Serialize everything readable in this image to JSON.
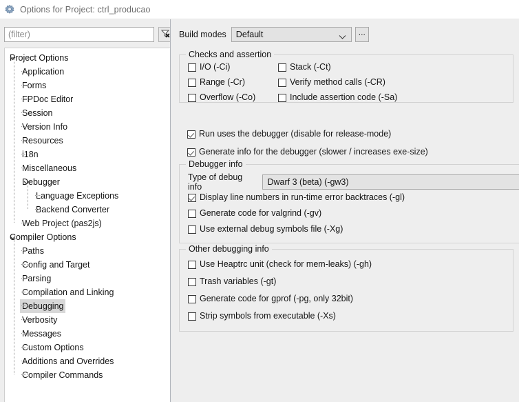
{
  "window": {
    "title": "Options for Project: ctrl_producao",
    "title_icon": "gear-icon"
  },
  "sidebar": {
    "filter": {
      "placeholder": "(filter)",
      "value": "",
      "clear_icon": "filter-clear-icon"
    },
    "items": [
      {
        "label": "Project Options",
        "level": 0,
        "expanded": true,
        "selected": false
      },
      {
        "label": "Application",
        "level": 1,
        "selected": false
      },
      {
        "label": "Forms",
        "level": 1,
        "selected": false
      },
      {
        "label": "FPDoc Editor",
        "level": 1,
        "selected": false
      },
      {
        "label": "Session",
        "level": 1,
        "selected": false
      },
      {
        "label": "Version Info",
        "level": 1,
        "selected": false
      },
      {
        "label": "Resources",
        "level": 1,
        "selected": false
      },
      {
        "label": "i18n",
        "level": 1,
        "selected": false
      },
      {
        "label": "Miscellaneous",
        "level": 1,
        "selected": false
      },
      {
        "label": "Debugger",
        "level": 1,
        "expanded": true,
        "selected": false
      },
      {
        "label": "Language Exceptions",
        "level": 2,
        "selected": false
      },
      {
        "label": "Backend Converter",
        "level": 2,
        "selected": false
      },
      {
        "label": "Web Project (pas2js)",
        "level": 1,
        "selected": false
      },
      {
        "label": "Compiler Options",
        "level": 0,
        "expanded": true,
        "selected": false
      },
      {
        "label": "Paths",
        "level": 1,
        "selected": false
      },
      {
        "label": "Config and Target",
        "level": 1,
        "selected": false
      },
      {
        "label": "Parsing",
        "level": 1,
        "selected": false
      },
      {
        "label": "Compilation and Linking",
        "level": 1,
        "selected": false
      },
      {
        "label": "Debugging",
        "level": 1,
        "selected": true
      },
      {
        "label": "Verbosity",
        "level": 1,
        "selected": false
      },
      {
        "label": "Messages",
        "level": 1,
        "selected": false
      },
      {
        "label": "Custom Options",
        "level": 1,
        "selected": false
      },
      {
        "label": "Additions and Overrides",
        "level": 1,
        "selected": false
      },
      {
        "label": "Compiler Commands",
        "level": 1,
        "selected": false
      }
    ]
  },
  "main": {
    "build_modes": {
      "label": "Build modes",
      "value": "Default",
      "more_button": "...",
      "chevron_icon": "chevron-down-icon"
    },
    "checks_group": {
      "title": "Checks and assertion",
      "items": [
        {
          "label": "I/O (-Ci)",
          "checked": false
        },
        {
          "label": "Stack (-Ct)",
          "checked": false
        },
        {
          "label": "Range (-Cr)",
          "checked": false
        },
        {
          "label": "Verify method calls (-CR)",
          "checked": false
        },
        {
          "label": "Overflow (-Co)",
          "checked": false
        },
        {
          "label": "Include assertion code (-Sa)",
          "checked": false
        }
      ]
    },
    "debugger_checks": [
      {
        "label": "Run uses the debugger (disable for release-mode)",
        "checked": true
      },
      {
        "label": "Generate info for the debugger (slower / increases exe-size)",
        "checked": true
      }
    ],
    "debugger_info_group": {
      "title": "Debugger info",
      "type_label": "Type of debug info",
      "type_value": "Dwarf 3 (beta) (-gw3)",
      "chevron_icon": "chevron-down-icon",
      "items": [
        {
          "label": "Display line numbers in run-time error backtraces (-gl)",
          "checked": true
        },
        {
          "label": "Generate code for valgrind (-gv)",
          "checked": false
        },
        {
          "label": "Use external debug symbols file (-Xg)",
          "checked": false
        }
      ]
    },
    "other_debugging_group": {
      "title": "Other debugging info",
      "items": [
        {
          "label": "Use Heaptrc unit (check for mem-leaks) (-gh)",
          "checked": false
        },
        {
          "label": "Trash variables (-gt)",
          "checked": false
        },
        {
          "label": "Generate code for gprof (-pg, only 32bit)",
          "checked": false
        },
        {
          "label": "Strip symbols from executable (-Xs)",
          "checked": false
        }
      ]
    }
  },
  "colors": {
    "background": "#eeeeee",
    "panel": "#ffffff",
    "selection": "#d8d8d8",
    "control": "#e3e3e3",
    "border": "#a8a8a8",
    "group_border": "#d2d2d2",
    "title_text": "#6d6d6d"
  }
}
